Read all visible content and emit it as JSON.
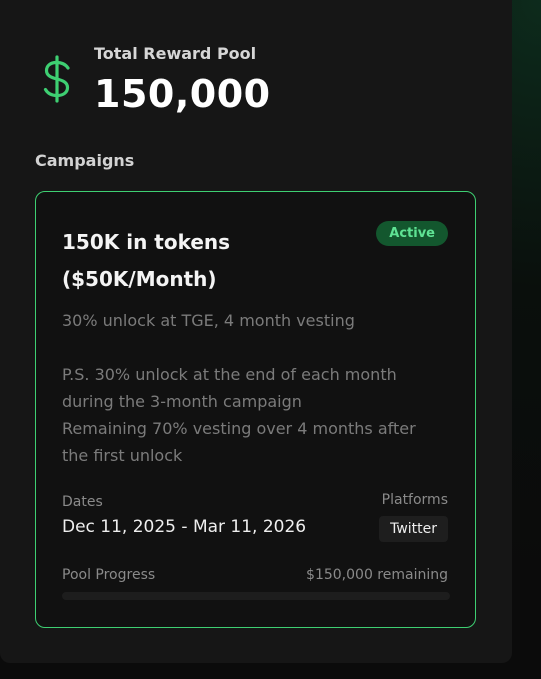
{
  "pool": {
    "icon": "dollar-icon",
    "label": "Total Reward Pool",
    "value": "150,000"
  },
  "campaigns": {
    "title": "Campaigns",
    "items": [
      {
        "title": "150K in tokens ($50K/Month)",
        "status": "Active",
        "description": "30% unlock at TGE, 4 month vesting",
        "note_lines": [
          "P.S. 30% unlock at the end of each month",
          "during the 3-month campaign",
          "Remaining 70% vesting over 4 months after",
          "the first unlock"
        ],
        "dates_label": "Dates",
        "dates_value": "Dec 11, 2025 - Mar 11, 2026",
        "platforms_label": "Platforms",
        "platform": "Twitter",
        "progress_label": "Pool Progress",
        "remaining_text": "$150,000 remaining",
        "progress_fraction": 0
      }
    ]
  },
  "colors": {
    "accent": "#3ecf72",
    "badge_bg": "#13572e",
    "badge_text": "#5fe394"
  }
}
